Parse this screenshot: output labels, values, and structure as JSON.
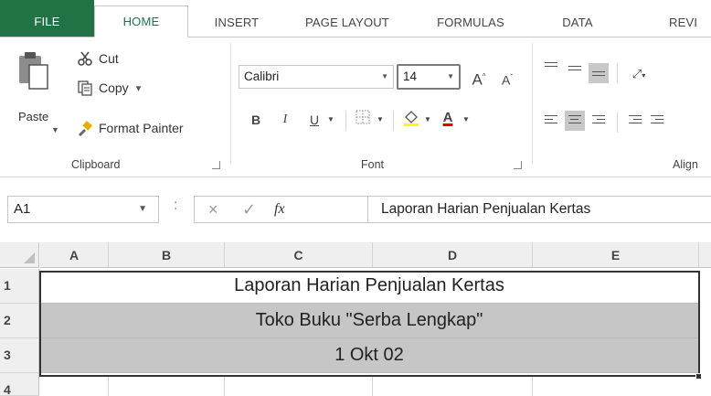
{
  "ribbon_tabs": [
    "FILE",
    "HOME",
    "INSERT",
    "PAGE LAYOUT",
    "FORMULAS",
    "DATA",
    "REVI"
  ],
  "active_tab": "HOME",
  "colors": {
    "file_tab": "#217346",
    "active_tab_text": "#217346",
    "selected_rows_fill": "#c6c6c6"
  },
  "clipboard": {
    "paste_label": "Paste",
    "cut_label": "Cut",
    "copy_label": "Copy",
    "copy_arrow": "▾",
    "format_painter_label": "Format Painter",
    "group_label": "Clipboard"
  },
  "font": {
    "name": "Calibri",
    "size": "14",
    "grow_label": "A",
    "shrink_label": "A",
    "bold": "B",
    "italic": "I",
    "underline": "U",
    "font_color_letter": "A",
    "group_label": "Font"
  },
  "alignment": {
    "group_label": "Align"
  },
  "formula_bar": {
    "name_box": "A1",
    "separator": ":",
    "cancel_symbol": "×",
    "enter_symbol": "✓",
    "fx_label": "fx",
    "content": "Laporan Harian Penjualan Kertas"
  },
  "grid": {
    "columns": [
      "A",
      "B",
      "C",
      "D",
      "E"
    ],
    "rows": [
      {
        "num": "1",
        "text": "Laporan Harian Penjualan Kertas"
      },
      {
        "num": "2",
        "text": "Toko Buku \"Serba Lengkap\""
      },
      {
        "num": "3",
        "text": "1 Okt 02"
      },
      {
        "num": "4",
        "text": ""
      }
    ]
  }
}
